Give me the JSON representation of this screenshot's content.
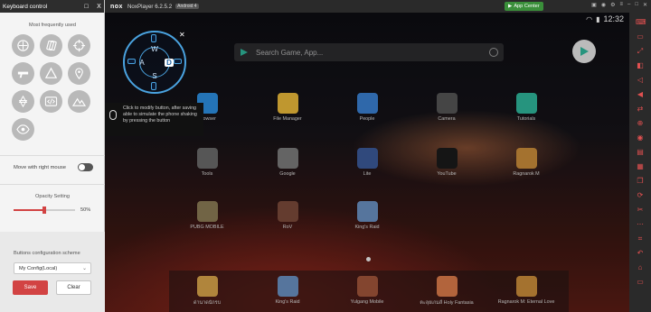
{
  "keyboard_panel": {
    "title": "Keyboard control",
    "header_buttons": [
      "□",
      "X"
    ],
    "frequent_label": "Most frequently used",
    "tools": [
      {
        "name": "joystick-icon"
      },
      {
        "name": "swipe-icon"
      },
      {
        "name": "crosshair-icon"
      },
      {
        "name": "gun-icon"
      },
      {
        "name": "triangle-icon"
      },
      {
        "name": "pin-icon"
      },
      {
        "name": "star-icon"
      },
      {
        "name": "code-icon"
      },
      {
        "name": "mountain-icon"
      },
      {
        "name": "eye-icon"
      }
    ],
    "move_right_mouse_label": "Move with right mouse",
    "opacity_label": "Opacity Setting",
    "opacity_value": "50%",
    "opacity_fraction": 0.5,
    "scheme_label": "Buttons configuration scheme",
    "scheme_selected": "My Config(Local)",
    "save_label": "Save",
    "clear_label": "Clear"
  },
  "titlebar": {
    "logo": "nox",
    "app_name": "NoxPlayer 6.2.5.2",
    "android_version": "Android 4",
    "app_center": "App Center"
  },
  "status_bar": {
    "time": "12:32"
  },
  "search": {
    "placeholder": "Search Game, App..."
  },
  "wasd": {
    "up": "W",
    "left": "A",
    "down": "S",
    "right": "D"
  },
  "tooltip": "Click to modify button, after saving able to simulate the phone shaking by pressing the button",
  "apps": [
    {
      "label": "Browser",
      "color": "#2d8ee0"
    },
    {
      "label": "File Manager",
      "color": "#e9b93a"
    },
    {
      "label": "People",
      "color": "#3a7fd0"
    },
    {
      "label": "Camera",
      "color": "#555555"
    },
    {
      "label": "Tutorials",
      "color": "#2fb59a"
    },
    {
      "label": "Tools",
      "color": "#6a6a6a"
    },
    {
      "label": "Google",
      "color": "#7a7a7a"
    },
    {
      "label": "Lite",
      "color": "#3b5998"
    },
    {
      "label": "YouTube",
      "color": "#1a1a1a"
    },
    {
      "label": "Ragnarok M",
      "color": "#c98b3a"
    },
    {
      "label": "PUBG MOBILE",
      "color": "#8a7a55"
    },
    {
      "label": "RoV",
      "color": "#7a4a3a"
    },
    {
      "label": "King's Raid",
      "color": "#6a8fc0"
    }
  ],
  "dock": [
    {
      "label": "ด่านาดนักรบ",
      "color": "#d7a34a"
    },
    {
      "label": "King's Raid",
      "color": "#6a8fc0"
    },
    {
      "label": "Yulgang Mobile",
      "color": "#a0553a"
    },
    {
      "label": "ตะลุยเกมส์ Holy Fantasia",
      "color": "#d97a4a"
    },
    {
      "label": "Ragnarok M: Eternal Love",
      "color": "#c98b3a"
    }
  ]
}
